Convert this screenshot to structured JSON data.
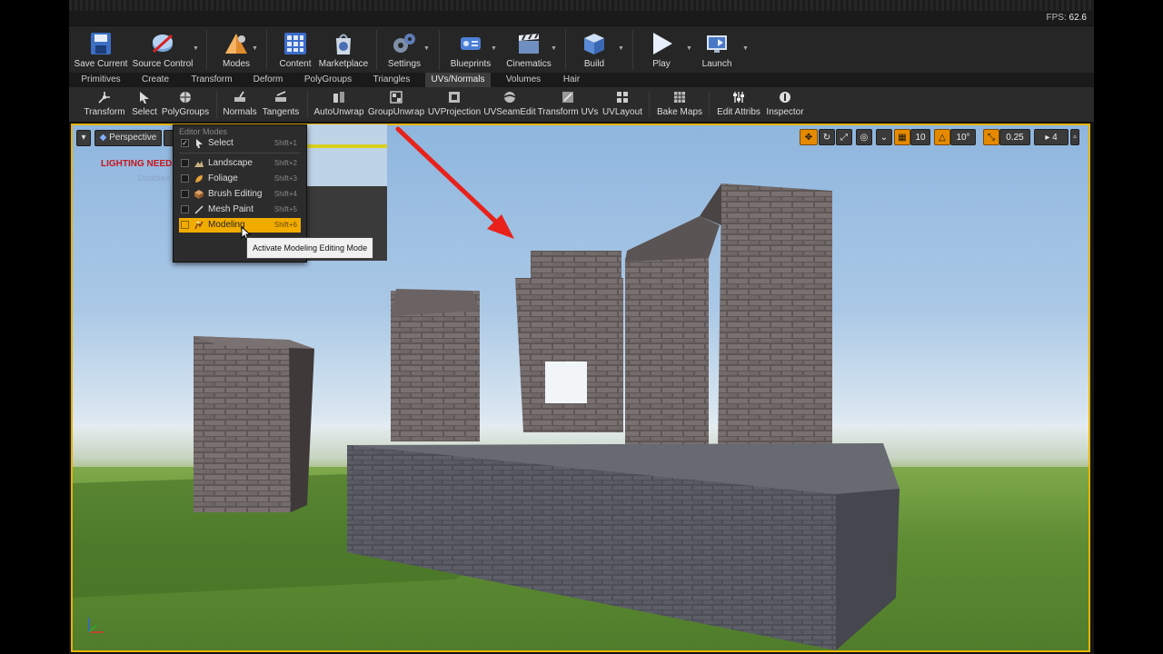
{
  "status": {
    "fps_label": "FPS:",
    "fps_value": "62.6"
  },
  "toolbar": {
    "buttons": [
      {
        "label": "Save Current",
        "icon": "save-icon"
      },
      {
        "label": "Source Control",
        "icon": "source-control-icon"
      },
      {
        "label": "Modes",
        "icon": "modes-icon"
      },
      {
        "label": "Content",
        "icon": "content-icon"
      },
      {
        "label": "Marketplace",
        "icon": "marketplace-icon"
      },
      {
        "label": "Settings",
        "icon": "settings-icon"
      },
      {
        "label": "Blueprints",
        "icon": "blueprints-icon"
      },
      {
        "label": "Cinematics",
        "icon": "cinematics-icon"
      },
      {
        "label": "Build",
        "icon": "build-icon"
      },
      {
        "label": "Play",
        "icon": "play-icon"
      },
      {
        "label": "Launch",
        "icon": "launch-icon"
      }
    ]
  },
  "tabs": [
    {
      "label": "Primitives"
    },
    {
      "label": "Create"
    },
    {
      "label": "Transform"
    },
    {
      "label": "Deform"
    },
    {
      "label": "PolyGroups"
    },
    {
      "label": "Triangles"
    },
    {
      "label": "UVs/Normals",
      "active": true
    },
    {
      "label": "Volumes"
    },
    {
      "label": "Hair"
    }
  ],
  "subtools": [
    {
      "label": "Transform"
    },
    {
      "label": "Select"
    },
    {
      "label": "PolyGroups"
    },
    {
      "label": "Normals"
    },
    {
      "label": "Tangents"
    },
    {
      "label": "AutoUnwrap"
    },
    {
      "label": "GroupUnwrap"
    },
    {
      "label": "UVProjection"
    },
    {
      "label": "UVSeamEdit"
    },
    {
      "label": "Transform UVs"
    },
    {
      "label": "UVLayout"
    },
    {
      "label": "Bake Maps"
    },
    {
      "label": "Edit Attribs"
    },
    {
      "label": "Inspector"
    }
  ],
  "viewport": {
    "perspective_label": "Perspective",
    "warning": "LIGHTING NEEDS",
    "warning_sub": "'DisableA",
    "grid_snap": "10",
    "rotation_snap": "10°",
    "scale_snap": "0.25",
    "camera_speed": "4"
  },
  "editor_modes": {
    "header": "Editor Modes",
    "items": [
      {
        "label": "Select",
        "shortcut": "Shift+1",
        "checked": true,
        "icon": "select-arrow-icon"
      },
      {
        "label": "Landscape",
        "shortcut": "Shift+2",
        "checked": false,
        "icon": "landscape-icon"
      },
      {
        "label": "Foliage",
        "shortcut": "Shift+3",
        "checked": false,
        "icon": "foliage-icon"
      },
      {
        "label": "Brush Editing",
        "shortcut": "Shift+4",
        "checked": false,
        "icon": "brush-editing-icon"
      },
      {
        "label": "Mesh Paint",
        "shortcut": "Shift+5",
        "checked": false,
        "icon": "mesh-paint-icon"
      },
      {
        "label": "Modeling",
        "shortcut": "Shift+6",
        "checked": false,
        "highlighted": true,
        "icon": "modeling-icon"
      }
    ],
    "tooltip": "Activate Modeling Editing Mode"
  },
  "colors": {
    "accent": "#f2ac00",
    "warning": "#c8161b",
    "arrow": "#e8211b",
    "viewport_border": "#e8b400"
  }
}
